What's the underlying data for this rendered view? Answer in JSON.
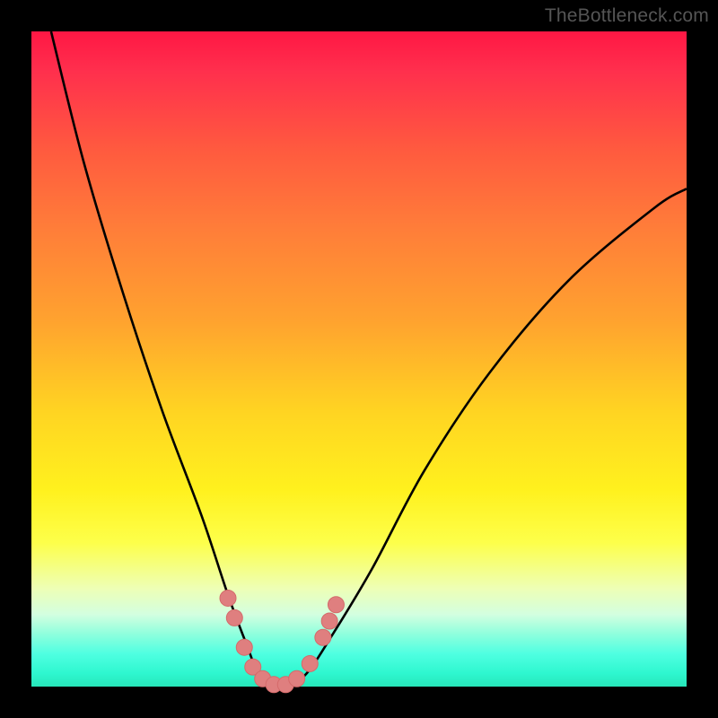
{
  "watermark": "TheBottleneck.com",
  "chart_data": {
    "type": "line",
    "title": "",
    "xlabel": "",
    "ylabel": "",
    "xlim": [
      0,
      100
    ],
    "ylim": [
      0,
      100
    ],
    "background_gradient": {
      "direction": "vertical",
      "stops": [
        {
          "pos": 0,
          "color": "#ff1744"
        },
        {
          "pos": 30,
          "color": "#ff7d39"
        },
        {
          "pos": 60,
          "color": "#ffd422"
        },
        {
          "pos": 85,
          "color": "#eeffb5"
        },
        {
          "pos": 100,
          "color": "#27e6b9"
        }
      ]
    },
    "series": [
      {
        "name": "bottleneck-curve",
        "color": "#000000",
        "x": [
          3,
          8,
          14,
          20,
          26,
          30,
          33,
          35,
          37,
          39,
          42,
          46,
          52,
          60,
          70,
          82,
          95,
          100
        ],
        "values": [
          100,
          80,
          60,
          42,
          26,
          14,
          6,
          1,
          0,
          0,
          2,
          8,
          18,
          33,
          48,
          62,
          73,
          76
        ]
      }
    ],
    "markers": {
      "name": "highlight-dots",
      "color": "#df7f7f",
      "stroke": "#d46a6a",
      "radius": 9,
      "points": [
        {
          "x": 30.0,
          "y": 13.5
        },
        {
          "x": 31.0,
          "y": 10.5
        },
        {
          "x": 32.5,
          "y": 6.0
        },
        {
          "x": 33.8,
          "y": 3.0
        },
        {
          "x": 35.3,
          "y": 1.2
        },
        {
          "x": 37.0,
          "y": 0.3
        },
        {
          "x": 38.8,
          "y": 0.3
        },
        {
          "x": 40.5,
          "y": 1.2
        },
        {
          "x": 42.5,
          "y": 3.5
        },
        {
          "x": 44.5,
          "y": 7.5
        },
        {
          "x": 45.5,
          "y": 10.0
        },
        {
          "x": 46.5,
          "y": 12.5
        }
      ]
    }
  }
}
